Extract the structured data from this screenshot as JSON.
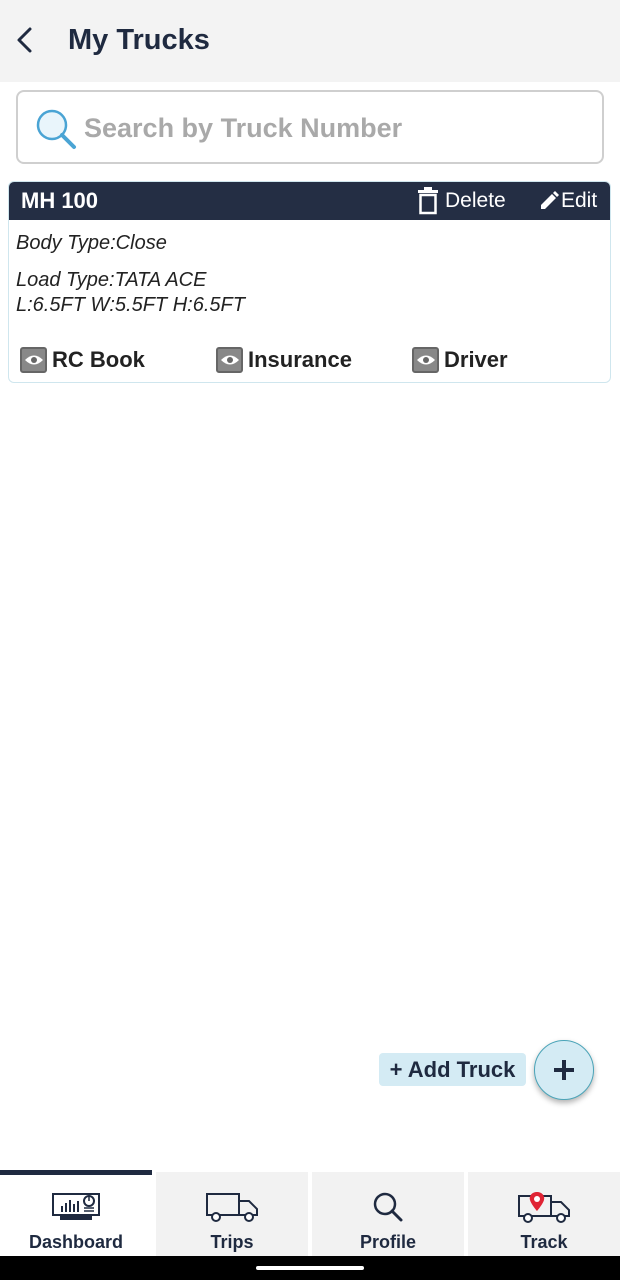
{
  "header": {
    "title": "My Trucks"
  },
  "search": {
    "placeholder": "Search by Truck Number",
    "value": ""
  },
  "trucks": [
    {
      "number": "MH 100",
      "delete_label": "Delete",
      "edit_label": "Edit",
      "body_type": "Body Type:Close",
      "load_type": "Load Type:TATA ACE",
      "dimensions": "L:6.5FT W:5.5FT H:6.5FT",
      "documents": [
        "RC Book",
        "Insurance",
        "Driver"
      ]
    }
  ],
  "add_truck": {
    "label": "+ Add Truck",
    "fab_icon": "plus-icon"
  },
  "bottom_nav": {
    "active": "Dashboard",
    "items": [
      {
        "label": "Dashboard",
        "icon": "dashboard-icon"
      },
      {
        "label": "Trips",
        "icon": "truck-icon"
      },
      {
        "label": "Profile",
        "icon": "search-icon"
      },
      {
        "label": "Track",
        "icon": "truck-location-icon"
      }
    ]
  },
  "colors": {
    "primary": "#1f2a40",
    "accent": "#d4ebf4",
    "card_header": "#242e44",
    "location_pin": "#e02434"
  }
}
